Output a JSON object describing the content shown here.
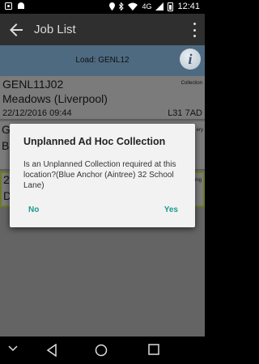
{
  "status_bar": {
    "time": "12:41",
    "network": "4G",
    "left_icons": [
      "notification-icon",
      "android-icon"
    ],
    "right_icons": [
      "location-icon",
      "bluetooth-icon",
      "wifi-icon",
      "signal-icon",
      "battery-icon"
    ]
  },
  "app_bar": {
    "title": "Job List"
  },
  "load_header": {
    "text": "Load: GENL12"
  },
  "jobs": [
    {
      "ref": "GENL11J02",
      "type": "Collection",
      "site": "Meadows (Liverpool)",
      "datetime": "22/12/2016 09:44",
      "postcode": "L31 7AD"
    }
  ],
  "partial_jobs": [
    {
      "left_1": "G",
      "left_2": "B",
      "right": "ery"
    },
    {
      "left_1": "2",
      "left_2": "D",
      "right": "ing"
    }
  ],
  "dialog": {
    "title": "Unplanned Ad Hoc Collection",
    "message": "Is an Unplanned Collection required at this location?(Blue Anchor (Aintree) 32 School Lane)",
    "no_label": "No",
    "yes_label": "Yes"
  },
  "colors": {
    "accent": "#1b9a8f",
    "load_header_bg": "#4d6a80",
    "app_bar_bg": "#2f2f2f"
  }
}
